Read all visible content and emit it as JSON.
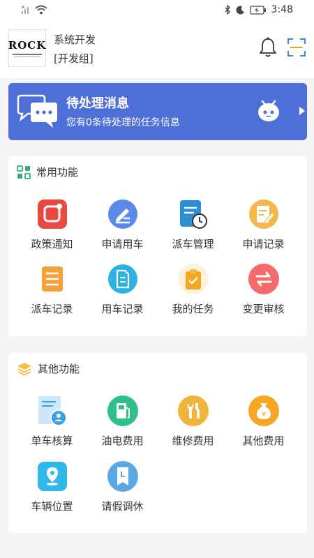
{
  "status_bar": {
    "time": "3:48"
  },
  "header": {
    "logo_text": "ROCK",
    "org_name": "系统开发",
    "group_name": "[开发组]"
  },
  "banner": {
    "title": "待处理消息",
    "subtitle": "您有0条待处理的任务信息"
  },
  "common": {
    "title": "常用功能",
    "items": [
      {
        "label": "政策通知",
        "icon": "policy-notice-icon",
        "color": "#e94a3f"
      },
      {
        "label": "申请用车",
        "icon": "apply-car-icon",
        "color": "#5a8be8"
      },
      {
        "label": "派车管理",
        "icon": "dispatch-manage-icon",
        "color": "#2a8fd6"
      },
      {
        "label": "申请记录",
        "icon": "apply-record-icon",
        "color": "#f5b64a"
      },
      {
        "label": "派车记录",
        "icon": "dispatch-record-icon",
        "color": "#f5a23b"
      },
      {
        "label": "用车记录",
        "icon": "usage-record-icon",
        "color": "#2fb0e6"
      },
      {
        "label": "我的任务",
        "icon": "my-task-icon",
        "color": "#f5a623"
      },
      {
        "label": "变更审核",
        "icon": "change-review-icon",
        "color": "#f56a6a"
      }
    ]
  },
  "other": {
    "title": "其他功能",
    "items": [
      {
        "label": "单车核算",
        "icon": "vehicle-accounting-icon",
        "color": "#3aa0e8"
      },
      {
        "label": "油电费用",
        "icon": "fuel-cost-icon",
        "color": "#2fbf8a"
      },
      {
        "label": "维修费用",
        "icon": "repair-cost-icon",
        "color": "#f0b43a"
      },
      {
        "label": "其他费用",
        "icon": "other-cost-icon",
        "color": "#f5a623"
      },
      {
        "label": "车辆位置",
        "icon": "vehicle-location-icon",
        "color": "#2fb8ea"
      },
      {
        "label": "请假调休",
        "icon": "leave-icon",
        "color": "#5ba8e6"
      }
    ]
  }
}
